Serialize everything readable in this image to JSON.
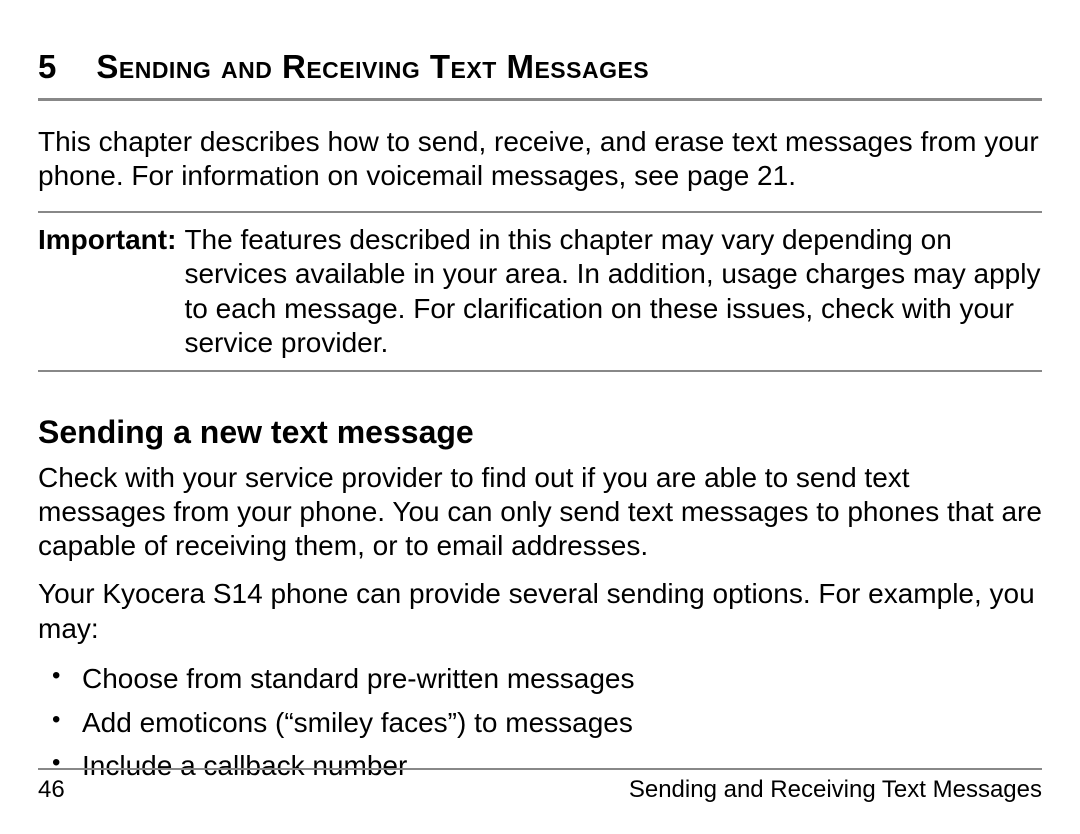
{
  "chapter": {
    "number": "5",
    "title": "Sending and Receiving Text Messages"
  },
  "intro": "This chapter describes how to send, receive, and erase text messages from your phone. For information on voicemail messages, see page 21.",
  "important": {
    "label": "Important:",
    "body": "The features described in this chapter may vary depending on services available in your area. In addition, usage charges may apply to each message. For clarification on these issues, check with your service provider."
  },
  "section": {
    "heading": "Sending a new text message",
    "para1": "Check with your service provider to find out if you are able to send text messages from your phone. You can only send text messages to phones that are capable of receiving them, or to email addresses.",
    "para2": "Your Kyocera S14 phone can provide several sending options. For example, you may:",
    "bullets": [
      "Choose from standard pre-written messages",
      "Add emoticons (“smiley faces”) to messages",
      "Include a callback number"
    ]
  },
  "footer": {
    "page": "46",
    "title": "Sending and Receiving Text Messages"
  }
}
